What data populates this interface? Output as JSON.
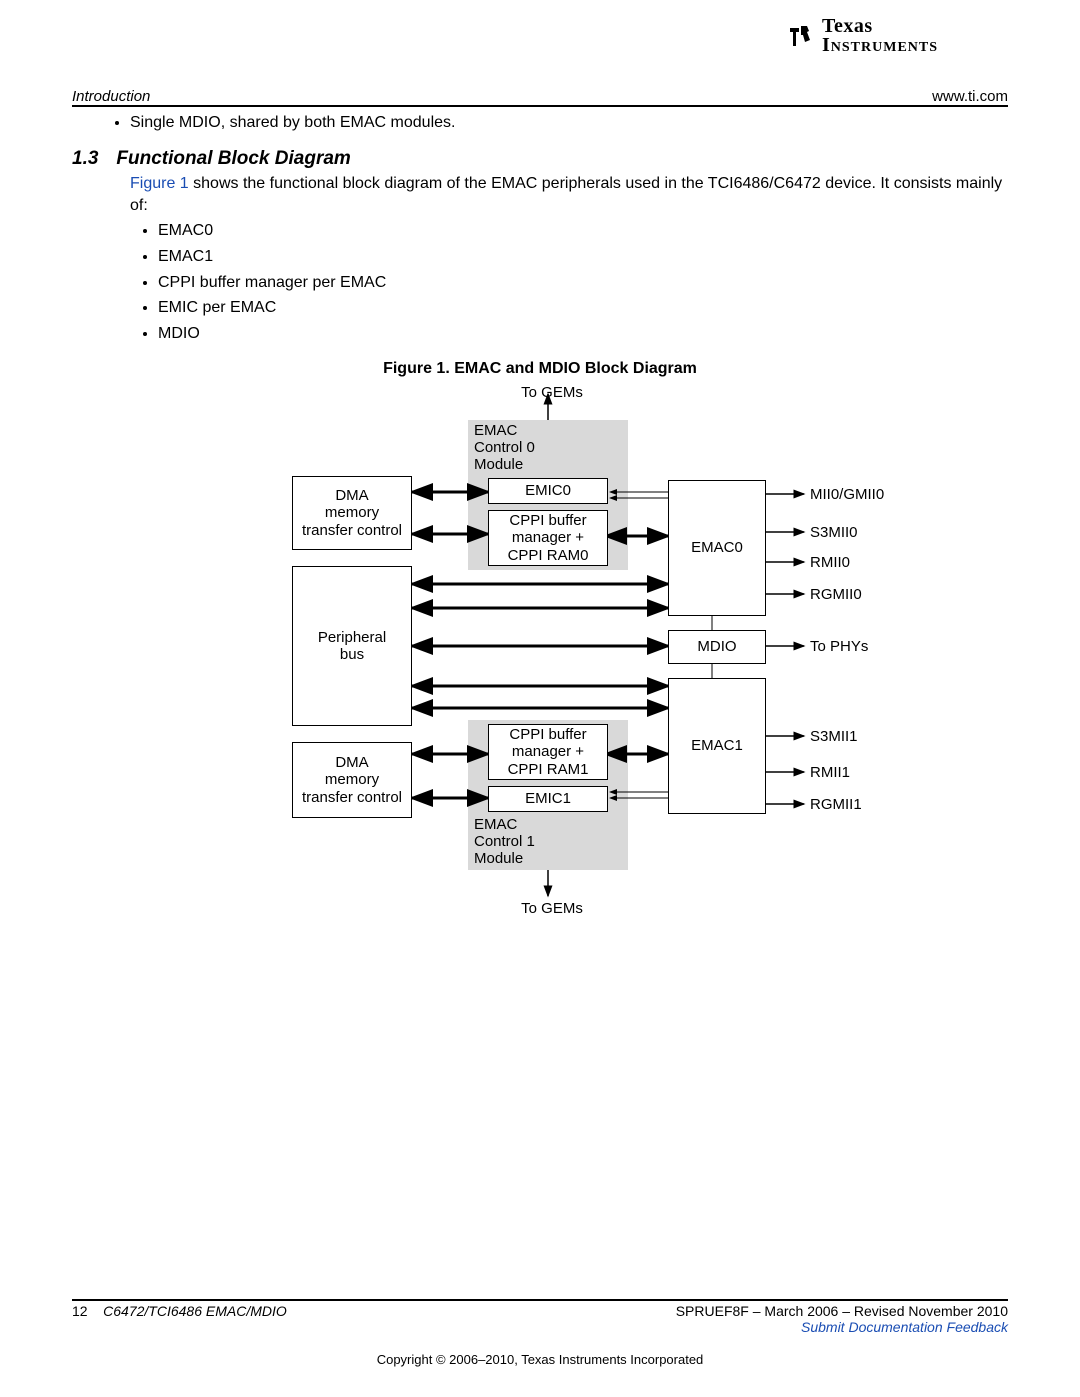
{
  "header": {
    "section": "Introduction",
    "site": "www.ti.com"
  },
  "logo": {
    "line1": "Texas",
    "line2": "Instruments"
  },
  "intro_bullet": "Single MDIO, shared by both EMAC modules.",
  "section": {
    "num": "1.3",
    "title": "Functional Block Diagram"
  },
  "para": {
    "link": "Figure 1",
    "rest": " shows the functional block diagram of the EMAC peripherals used in the TCI6486/C6472 device. It consists mainly of:"
  },
  "components": [
    "EMAC0",
    "EMAC1",
    "CPPI buffer manager per EMAC",
    "EMIC per EMAC",
    "MDIO"
  ],
  "figure_caption": "Figure 1. EMAC and MDIO Block Diagram",
  "diagram": {
    "top_label": "To GEMs",
    "bottom_label": "To GEMs",
    "emac_ctrl0": "EMAC\nControl 0\nModule",
    "emac_ctrl1": "EMAC\nControl 1\nModule",
    "dma0": "DMA\nmemory\ntransfer control",
    "dma1": "DMA\nmemory\ntransfer control",
    "periph": "Peripheral\nbus",
    "emic0": "EMIC0",
    "emic1": "EMIC1",
    "cppi0": "CPPI buffer\nmanager +\nCPPI RAM0",
    "cppi1": "CPPI buffer\nmanager +\nCPPI RAM1",
    "emac0": "EMAC0",
    "emac1": "EMAC1",
    "mdio": "MDIO",
    "sig": {
      "mii0": "MII0/GMII0",
      "s3mii0": "S3MII0",
      "rmii0": "RMII0",
      "rgmii0": "RGMII0",
      "tophy": "To PHYs",
      "s3mii1": "S3MII1",
      "rmii1": "RMII1",
      "rgmii1": "RGMII1"
    }
  },
  "footer": {
    "page": "12",
    "doc": "C6472/TCI6486 EMAC/MDIO",
    "rev": "SPRUEF8F – March 2006 – Revised November 2010",
    "feedback": "Submit Documentation Feedback",
    "copyright": "Copyright © 2006–2010, Texas Instruments Incorporated"
  }
}
